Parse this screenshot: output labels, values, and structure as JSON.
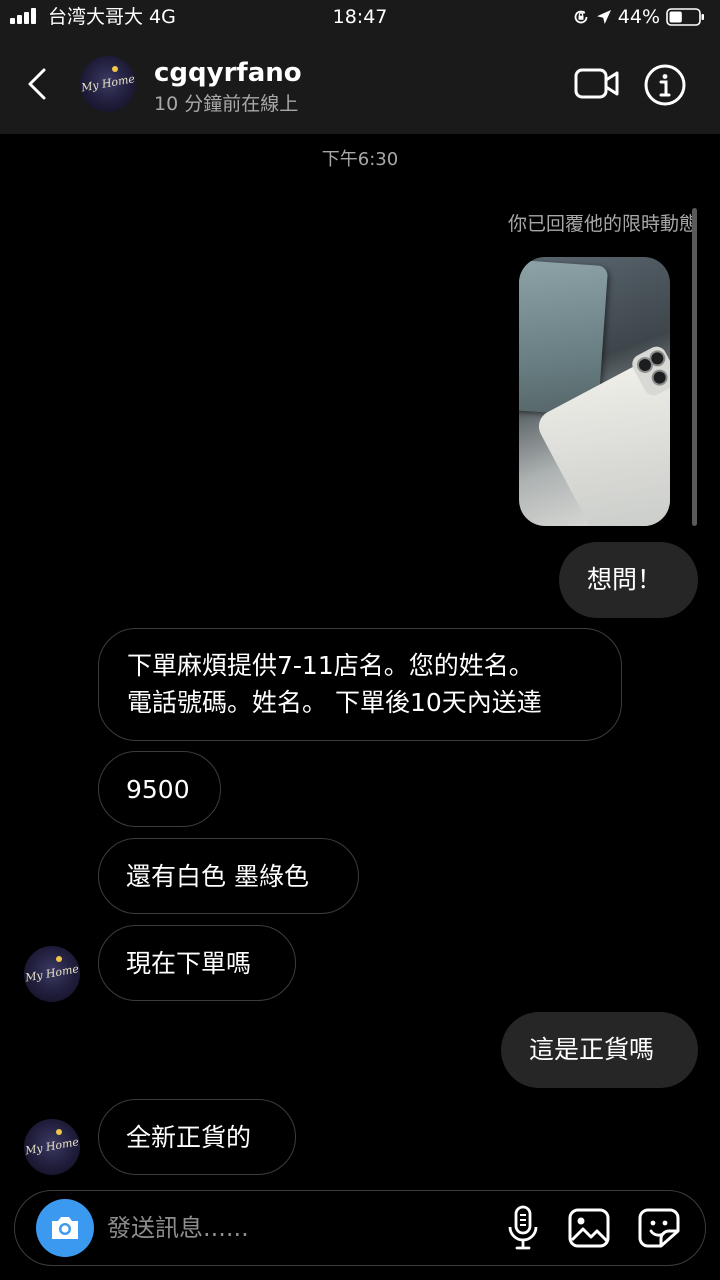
{
  "status_bar": {
    "carrier": "台湾大哥大 4G",
    "time": "18:47",
    "battery_percent": "44%",
    "battery_level": 0.44
  },
  "header": {
    "back_icon": "chevron-left-icon",
    "name": "cgqyrfano",
    "status": "10 分鐘前在線上",
    "avatar_text": "My Home",
    "video_icon": "video-camera-icon",
    "info_icon": "info-icon"
  },
  "chat": {
    "timestamp": "下午6:30",
    "story_reply_note": "你已回覆他的限時動態",
    "messages": [
      {
        "id": "m1",
        "direction": "outgoing",
        "lines": [
          "想問！"
        ]
      },
      {
        "id": "m2",
        "direction": "incoming",
        "lines": [
          "下單麻煩提供7-11店名。您的姓名。",
          "電話號碼。姓名。 下單後10天內送達"
        ]
      },
      {
        "id": "m3",
        "direction": "incoming",
        "lines": [
          "9500"
        ]
      },
      {
        "id": "m4",
        "direction": "incoming",
        "lines": [
          "還有白色 墨綠色"
        ]
      },
      {
        "id": "m5",
        "direction": "incoming",
        "lines": [
          "現在下單嗎"
        ]
      },
      {
        "id": "m6",
        "direction": "outgoing",
        "lines": [
          "這是正貨嗎"
        ]
      },
      {
        "id": "m7",
        "direction": "incoming",
        "lines": [
          "全新正貨的"
        ]
      }
    ]
  },
  "composer": {
    "placeholder": "發送訊息......",
    "value": "",
    "camera_icon": "camera-icon",
    "mic_icon": "microphone-icon",
    "gallery_icon": "image-gallery-icon",
    "sticker_icon": "sticker-icon",
    "camera_button_color": "#3b99f0"
  }
}
